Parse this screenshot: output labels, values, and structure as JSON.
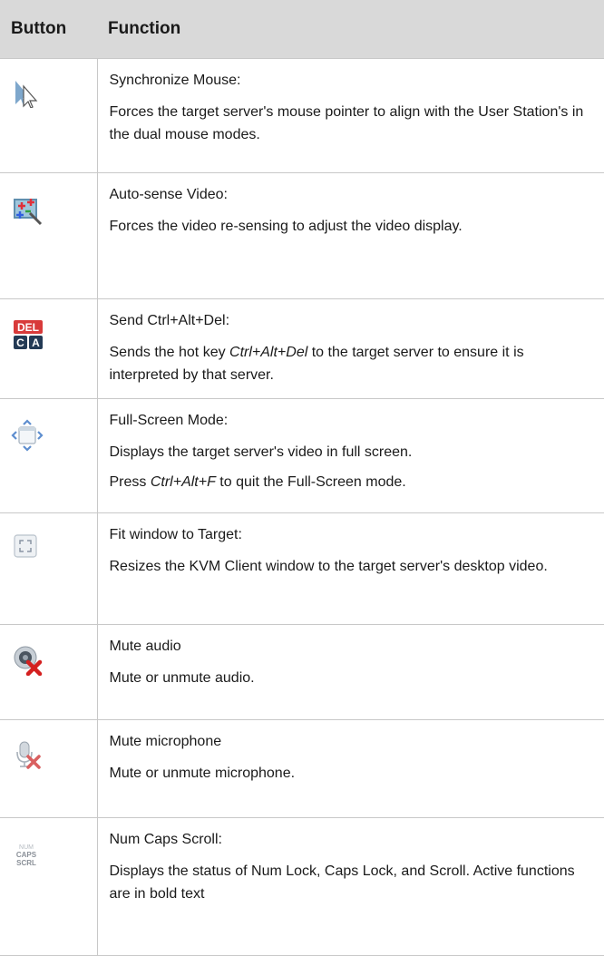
{
  "header": {
    "button": "Button",
    "function": "Function"
  },
  "rows": [
    {
      "icon": "synchronize-mouse-icon",
      "title": "Synchronize Mouse:",
      "desc": "Forces the target server's mouse pointer to align with the User Station's in the dual mouse modes."
    },
    {
      "icon": "auto-sense-video-icon",
      "title": "Auto-sense Video:",
      "desc": "Forces the video re-sensing to adjust the video display."
    },
    {
      "icon": "send-ctrl-alt-del-icon",
      "icon_text_top": "DEL",
      "icon_text_c": "C",
      "icon_text_a": "A",
      "title": "Send Ctrl+Alt+Del:",
      "desc_before": "Sends the hot key ",
      "desc_em": "Ctrl+Alt+Del",
      "desc_after": " to the target server to ensure it is interpreted by that server."
    },
    {
      "icon": "full-screen-mode-icon",
      "title": "Full-Screen Mode:",
      "desc": "Displays the target server's video in full screen.",
      "extra_before": "Press ",
      "extra_em": "Ctrl+Alt+F",
      "extra_after": " to quit the Full-Screen mode."
    },
    {
      "icon": "fit-window-icon",
      "title": "Fit window to Target:",
      "desc": "Resizes the KVM Client window to the target server's desktop video."
    },
    {
      "icon": "mute-audio-icon",
      "title": "Mute audio",
      "desc": "Mute or unmute audio."
    },
    {
      "icon": "mute-microphone-icon",
      "title": "Mute microphone",
      "desc": "Mute or unmute microphone."
    },
    {
      "icon": "num-caps-scroll-icon",
      "icon_text_1": "NUM",
      "icon_text_2": "CAPS",
      "icon_text_3": "SCRL",
      "title": "Num Caps Scroll:",
      "desc": "Displays the status of Num Lock, Caps Lock, and Scroll. Active functions are in bold text"
    }
  ]
}
